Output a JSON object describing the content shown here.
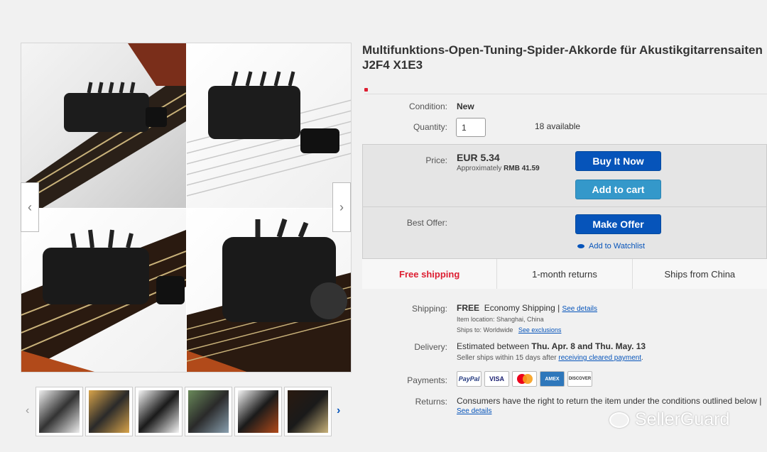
{
  "listing": {
    "title": "Multifunktions-Open-Tuning-Spider-Akkorde für Akustikgitarrensaiten J2F4 X1E3"
  },
  "details": {
    "condition_label": "Condition:",
    "condition_value": "New",
    "quantity_label": "Quantity:",
    "quantity_value": "1",
    "available": "18 available"
  },
  "pricing": {
    "price_label": "Price:",
    "price": "EUR 5.34",
    "approx_prefix": "Approximately",
    "approx_value": "RMB 41.59",
    "best_offer_label": "Best Offer:"
  },
  "buttons": {
    "buy_now": "Buy It Now",
    "add_to_cart": "Add to cart",
    "make_offer": "Make Offer",
    "watchlist": "Add to Watchlist"
  },
  "badges": {
    "free_shipping": "Free shipping",
    "returns": "1-month returns",
    "ships_from": "Ships from China"
  },
  "shipping": {
    "label": "Shipping:",
    "free": "FREE",
    "method": "Economy Shipping |",
    "see_details": "See details",
    "location": "Item location:  Shanghai, China",
    "ships_to_prefix": "Ships to:  Worldwide",
    "see_exclusions": "See exclusions"
  },
  "delivery": {
    "label": "Delivery:",
    "text_prefix": "Estimated between",
    "range": "Thu. Apr. 8 and Thu. May. 13",
    "note_prefix": "Seller ships within 15 days after",
    "note_link": "receiving cleared payment",
    "note_suffix": "."
  },
  "payments": {
    "label": "Payments:",
    "methods": [
      "PayPal",
      "VISA",
      "MasterCard",
      "AMEX",
      "DISCOVER"
    ]
  },
  "returns": {
    "label": "Returns:",
    "text": "Consumers have the right to return the item under the conditions outlined below |",
    "see_details": "See details"
  },
  "watermark": {
    "text": "SellerGuard"
  },
  "colors": {
    "ebay_blue": "#0654ba",
    "cart_blue": "#3498ca",
    "free_red": "#dd1e31"
  },
  "icons": {
    "prev": "chevron-left-icon",
    "next": "chevron-right-icon",
    "watch": "eye-icon"
  }
}
